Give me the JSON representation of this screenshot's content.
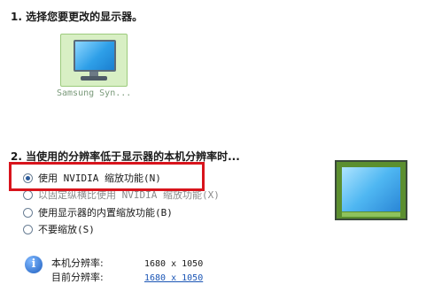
{
  "step1": {
    "heading": "1. 选择您要更改的显示器。"
  },
  "monitor": {
    "label": "Samsung Syn..."
  },
  "step2": {
    "heading": "2. 当使用的分辨率低于显示器的本机分辨率时..."
  },
  "options": [
    {
      "label": "使用 NVIDIA 缩放功能(N)",
      "selected": true
    },
    {
      "label": "以固定纵横比使用 NVIDIA 缩放功能(X)",
      "selected": false
    },
    {
      "label": "使用显示器的内置缩放功能(B)",
      "selected": false
    },
    {
      "label": "不要缩放(S)",
      "selected": false
    }
  ],
  "info": {
    "icon": "info-icon",
    "native_label": "本机分辨率:",
    "native_value": "1680 x 1050",
    "current_label": "目前分辨率:",
    "current_value": "1680 x 1050"
  },
  "colors": {
    "highlight": "#d8141c",
    "link": "#1a55b5",
    "tile": "#d8efc4"
  }
}
